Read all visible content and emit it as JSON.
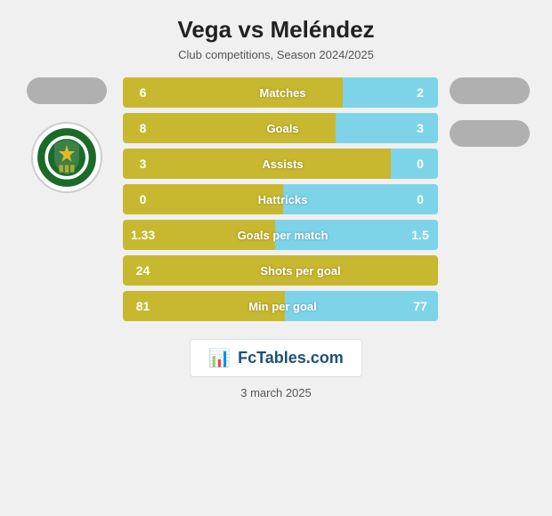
{
  "header": {
    "title": "Vega vs Meléndez",
    "subtitle": "Club competitions, Season 2024/2025"
  },
  "stats": [
    {
      "label": "Matches",
      "left_val": "6",
      "right_val": "2",
      "left_pct": 75,
      "right_pct": 25
    },
    {
      "label": "Goals",
      "left_val": "8",
      "right_val": "3",
      "left_pct": 72,
      "right_pct": 28
    },
    {
      "label": "Assists",
      "left_val": "3",
      "right_val": "0",
      "left_pct": 100,
      "right_pct": 5
    },
    {
      "label": "Hattricks",
      "left_val": "0",
      "right_val": "0",
      "left_pct": 50,
      "right_pct": 50
    },
    {
      "label": "Goals per match",
      "left_val": "1.33",
      "right_val": "1.5",
      "left_pct": 47,
      "right_pct": 53
    },
    {
      "label": "Shots per goal",
      "left_val": "24",
      "right_val": null,
      "left_pct": 100,
      "right_pct": 0,
      "no_right": true
    },
    {
      "label": "Min per goal",
      "left_val": "81",
      "right_val": "77",
      "left_pct": 51,
      "right_pct": 49
    }
  ],
  "branding": {
    "fctables": "FcTables.com"
  },
  "footer": {
    "date": "3 march 2025"
  }
}
